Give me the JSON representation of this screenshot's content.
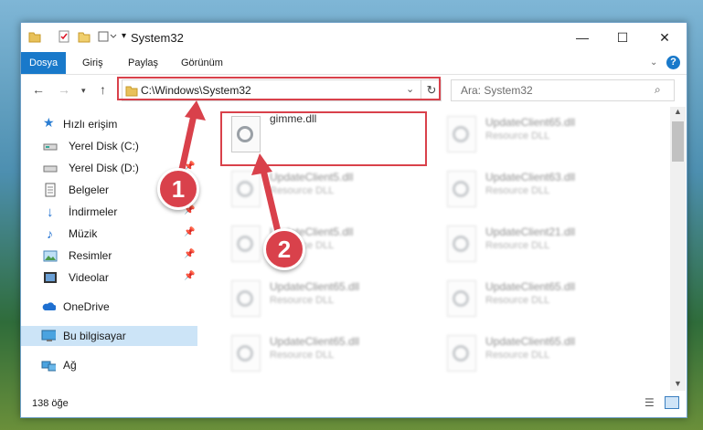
{
  "window": {
    "title": "System32"
  },
  "ribbon": {
    "tabs": [
      "Dosya",
      "Giriş",
      "Paylaş",
      "Görünüm"
    ]
  },
  "address": {
    "path": "C:\\Windows\\System32"
  },
  "search": {
    "placeholder": "Ara: System32"
  },
  "sidebar": {
    "items": [
      {
        "label": "Hızlı erişim",
        "icon": "star-icon",
        "pinned": false
      },
      {
        "label": "Yerel Disk (C:)",
        "icon": "drive-icon",
        "pinned": false
      },
      {
        "label": "Yerel Disk (D:)",
        "icon": "drive-icon",
        "pinned": true
      },
      {
        "label": "Belgeler",
        "icon": "documents-icon",
        "pinned": true
      },
      {
        "label": "İndirmeler",
        "icon": "download-icon",
        "pinned": true
      },
      {
        "label": "Müzik",
        "icon": "music-icon",
        "pinned": true
      },
      {
        "label": "Resimler",
        "icon": "pictures-icon",
        "pinned": true
      },
      {
        "label": "Videolar",
        "icon": "video-icon",
        "pinned": true
      },
      {
        "label": "OneDrive",
        "icon": "cloud-icon",
        "pinned": false
      },
      {
        "label": "Bu bilgisayar",
        "icon": "computer-icon",
        "pinned": false
      },
      {
        "label": "Ağ",
        "icon": "network-icon",
        "pinned": false
      }
    ]
  },
  "files": [
    {
      "name": "gimme.dll",
      "type": ""
    },
    {
      "name": "UpdateClient65.dll",
      "type": "Resource DLL"
    },
    {
      "name": "UpdateClient5.dll",
      "type": "Resource DLL"
    },
    {
      "name": "UpdateClient63.dll",
      "type": "Resource DLL"
    },
    {
      "name": "UpdateClient5.dll",
      "type": "Resource DLL"
    },
    {
      "name": "UpdateClient21.dll",
      "type": "Resource DLL"
    },
    {
      "name": "UpdateClient65.dll",
      "type": "Resource DLL"
    },
    {
      "name": "UpdateClient65.dll",
      "type": "Resource DLL"
    },
    {
      "name": "UpdateClient65.dll",
      "type": "Resource DLL"
    },
    {
      "name": "UpdateClient65.dll",
      "type": "Resource DLL"
    }
  ],
  "status": {
    "count": "138 öğe"
  },
  "annotations": {
    "step1": "1",
    "step2": "2"
  },
  "colors": {
    "accent": "#1979ca",
    "highlight": "#d9414b",
    "selected": "#cce4f7"
  }
}
